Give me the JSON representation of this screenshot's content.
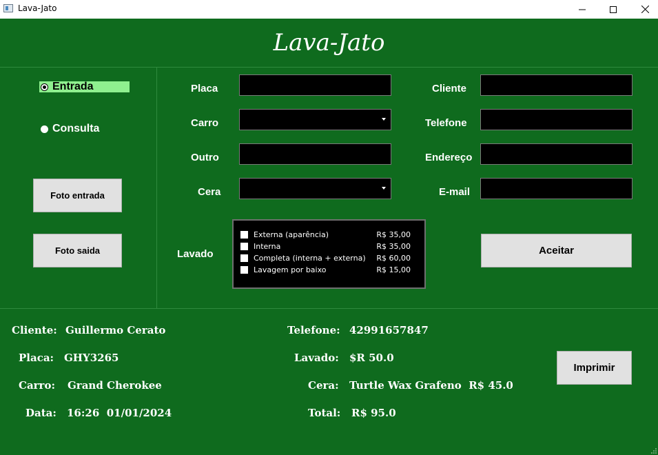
{
  "window": {
    "title": "Lava-Jato"
  },
  "header": {
    "title": "Lava-Jato"
  },
  "mode": {
    "entrada_label": "Entrada",
    "consulta_label": "Consulta",
    "selected": "Entrada"
  },
  "photo_buttons": {
    "entrada": "Foto entrada",
    "saida": "Foto saida"
  },
  "form": {
    "placa_label": "Placa",
    "carro_label": "Carro",
    "outro_label": "Outro",
    "cera_label": "Cera",
    "lavado_label": "Lavado",
    "cliente_label": "Cliente",
    "telefone_label": "Telefone",
    "endereco_label": "Endereço",
    "email_label": "E-mail",
    "placa_value": "",
    "outro_value": "",
    "cliente_value": "",
    "telefone_value": "",
    "endereco_value": "",
    "email_value": "",
    "carro_selected": "",
    "cera_selected": "",
    "aceitar_label": "Aceitar"
  },
  "lavado_options": [
    {
      "label": "Externa (aparência)",
      "price": "R$ 35,00",
      "checked": false
    },
    {
      "label": "Interna",
      "price": "R$ 35,00",
      "checked": false
    },
    {
      "label": "Completa (interna + externa)",
      "price": "R$ 60,00",
      "checked": false
    },
    {
      "label": "Lavagem por baixo",
      "price": "R$ 15,00",
      "checked": false
    }
  ],
  "summary": {
    "cliente_label": "Cliente:",
    "cliente_value": "Guillermo Cerato",
    "placa_label": "Placa:",
    "placa_value": "GHY3265",
    "carro_label": "Carro:",
    "carro_value": "Grand Cherokee",
    "data_label": "Data:",
    "data_value": "16:26  01/01/2024",
    "telefone_label": "Telefone:",
    "telefone_value": "42991657847",
    "lavado_label": "Lavado:",
    "lavado_value": "$R 50.0",
    "cera_label": "Cera:",
    "cera_value": "Turtle Wax Grafeno  R$ 45.0",
    "total_label": "Total:",
    "total_value": "R$ 95.0",
    "imprimir_label": "Imprimir"
  },
  "colors": {
    "background": "#0f6b1e",
    "radio_highlight": "#8ff08f",
    "field_bg": "#000000",
    "button_bg": "#e1e1e1"
  }
}
